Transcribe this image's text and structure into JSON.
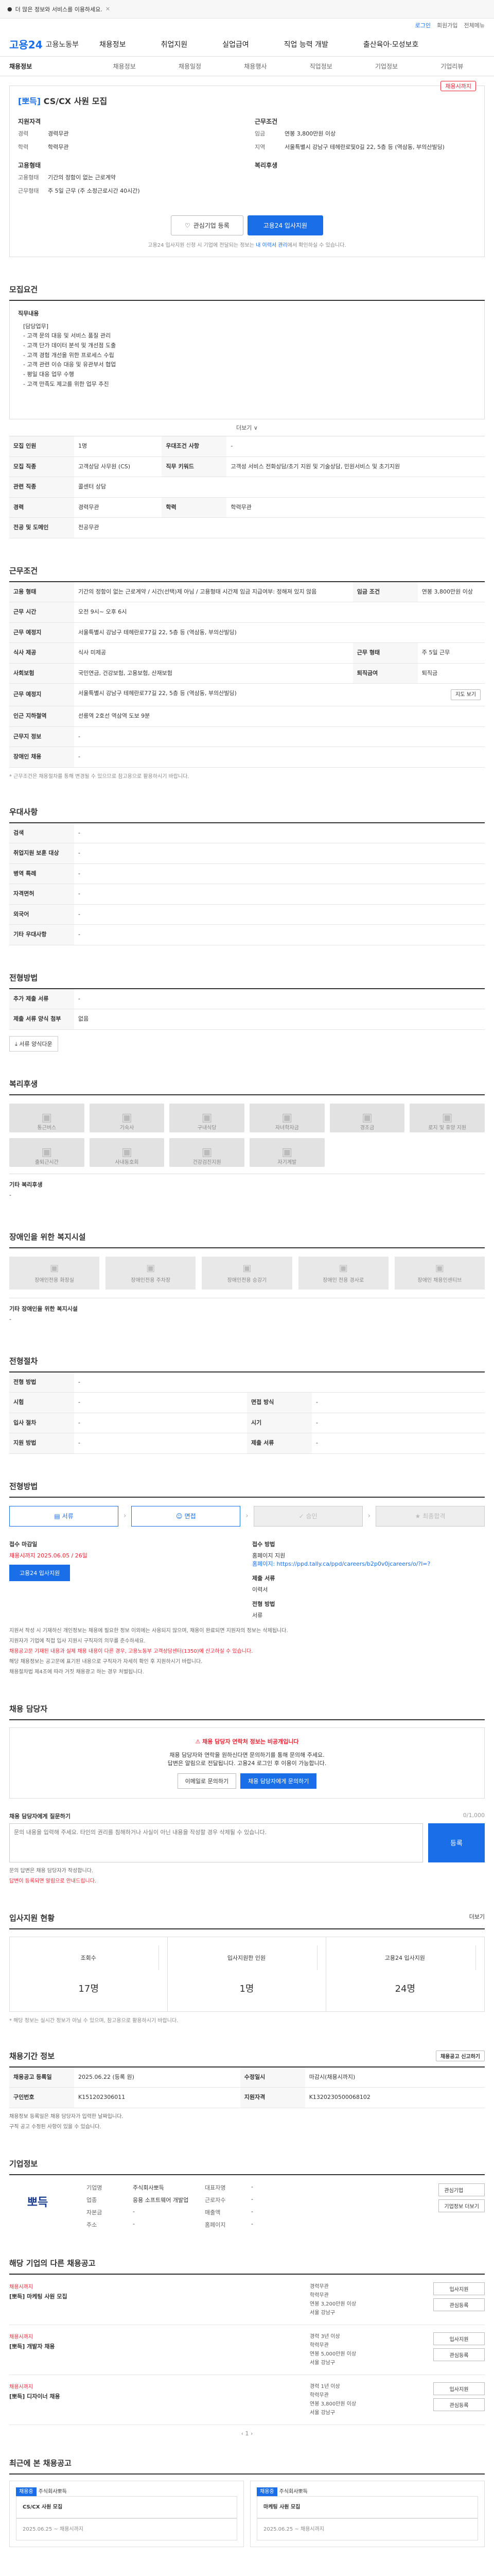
{
  "top": {
    "label": "더 많은 정보와 서비스를 이용하세요.",
    "close": "✕"
  },
  "util": {
    "login": "로그인",
    "join": "회원가입",
    "lang": "전체메뉴"
  },
  "header": {
    "logo": "고용24",
    "gov": "고용노동부",
    "gnb": [
      "채용정보",
      "취업지원",
      "실업급여",
      "직업 능력 개발",
      "출산육아·모성보호"
    ]
  },
  "subnav": {
    "first": "채용정보",
    "items": [
      "채용정보",
      "채용일정",
      "채용행사",
      "직업정보",
      "기업정보",
      "기업리뷰"
    ]
  },
  "job": {
    "company": "[뽀득]",
    "title": "CS/CX 사원 모집",
    "badge": "채용시까지",
    "left_h": "지원자격",
    "left_rows": [
      [
        "경력",
        "경력무관"
      ],
      [
        "학력",
        "학력무관"
      ]
    ],
    "left_h2": "고용형태",
    "left_rows2": [
      [
        "고용형태",
        "기간의 정함이 없는 근로계약"
      ],
      [
        "근무형태",
        "주 5일 근무 (주 소정근로시간 40시간)"
      ]
    ],
    "right_h": "근무조건",
    "right_rows": [
      [
        "임금",
        "연봉 3,800만원 이상"
      ],
      [
        "지역",
        "서울특별시 강남구 테헤란로띷0길 22, 5층 등 (역삼동, 부의산빌딩)"
      ]
    ],
    "right_h2": "복리후생",
    "btn_fav": "관심기업 등록",
    "btn_apply": "고용24 입사지원",
    "note_pre": "고용24 입사지원 신청 시 기업에 전달되는 정보는",
    "note_link": "내 이력서 관리",
    "note_post": "에서 확인하실 수 있습니다."
  },
  "detail": {
    "h": "모집요건",
    "title": "직무내용",
    "lines": [
      "[담당업무]",
      "- 고객 문의 대응 및 서비스 품질 관리",
      "- 고객 단가 데이터 분석 및 개선점 도출",
      "- 고객 경험 개선을 위한 프로세스 수립",
      "- 고객 관련 이슈 대응 및 유관부서 협업",
      "- 평일 대응 업무 수행",
      "- 고객 만족도 제고를 위한 업무 추진"
    ],
    "more": "더보기 ∨"
  },
  "req": {
    "rows": [
      [
        "모집 인원",
        "1명",
        "우대조건 사항",
        "-"
      ],
      [
        "모집 직종",
        "고객상담 사무원 (CS)",
        "직무 키워드",
        "고객성 서비스 전화상담/초기 지원 및 기술상담, 민원서비스 및 초기지원"
      ],
      [
        "관련 직종",
        "콜센터 상담",
        "",
        ""
      ],
      [
        "경력",
        "경력무관",
        "학력",
        "학력무관"
      ],
      [
        "전공 및 도메인",
        "전공무관",
        "",
        ""
      ]
    ]
  },
  "cond": {
    "h": "근무조건",
    "rows": [
      [
        "고용 형태",
        "기간의 정함이 없는 근로계약 / 시간(선택)제 아님 / 고용형태 시간제 임금 지급여부: 정해져 있지 않음",
        "임금 조건",
        "연봉 3,800만원 이상"
      ],
      [
        "근무 시간",
        "오전 9시~ 오후 6시",
        "",
        ""
      ],
      [
        "근무 예정지",
        "서울특별시 강남구 테헤란로77길 22, 5층 등 (역삼동, 부의산빌딩)",
        "",
        ""
      ],
      [
        "식사 제공",
        "식사 미제공",
        "근무 형태",
        "주 5일 근무"
      ],
      [
        "사회보험",
        "국민연금, 건강보험, 고용보험, 산재보험",
        "퇴직금여",
        "퇴직금"
      ],
      [
        "근무 예정지",
        "서울특별시 강남구 테헤란로77길 22, 5층 등 (역삼동, 부의산빌딩)",
        "",
        ""
      ],
      [
        "인근 지하철역",
        "선릉역 2호선 역삼역 도보 9분",
        "",
        ""
      ],
      [
        "근무지 정보",
        "-",
        "",
        ""
      ],
      [
        "장애인 채용",
        "-",
        "",
        ""
      ]
    ],
    "map_btn": "지도 보기",
    "foot": "* 근무조건은 채용절차를 통해 변경될 수 있으므로 참고용으로 활용하시기 바랍니다."
  },
  "priv": {
    "h": "우대사항",
    "rows": [
      [
        "검색",
        "-"
      ],
      [
        "취업지원 보훈 대상",
        "-"
      ],
      [
        "병역 특례",
        "-"
      ],
      [
        "자격면허",
        "-"
      ],
      [
        "외국어",
        "-"
      ],
      [
        "기타 우대사항",
        "-"
      ]
    ]
  },
  "proc": {
    "h": "전형방법",
    "rows": [
      [
        "추가 제출 서류",
        "-"
      ],
      [
        "제출 서류 양식 첨부",
        "없음"
      ]
    ],
    "chip": "서류 양식다운"
  },
  "welfare": {
    "h": "복리후생",
    "items": [
      "통근버스",
      "기숙사",
      "구내식당",
      "자녀학자금",
      "경조금",
      "로지 및 휴양 지원",
      "출퇴근시간",
      "사내동호회",
      "건강검진지원",
      "자기계발"
    ],
    "etc_k": "기타 복리후생",
    "etc_v": "-"
  },
  "hire": {
    "h": "장애인을 위한 복지시설",
    "items": [
      "장애인전용 화장실",
      "장애인전용 주차장",
      "장애인전용 승강기",
      "장애인 전용 경사로",
      "장애인 채용인센티브"
    ],
    "etc_k": "기타 장애인을 위한 복지시설",
    "etc_v": "-"
  },
  "apply_sec": {
    "h": "전형절차",
    "rows": [
      [
        "전형 방법",
        "-"
      ],
      [
        "시험",
        "-",
        "면접 방식",
        "-"
      ],
      [
        "입사 절차",
        "-",
        "시기",
        "-"
      ],
      [
        "지원 방법",
        "-",
        "제출 서류",
        "-"
      ]
    ]
  },
  "steps": {
    "h": "전형방법",
    "items": [
      "서류",
      "면접",
      "승인",
      "최종합격"
    ]
  },
  "applyinfo": {
    "k1": "접수 마감일",
    "v1": "채용시까지 2025.06.05 / 26일",
    "k2": "접수 방법",
    "v2": "홈페이지 지원",
    "v2b": "홈페이지: https://ppd.tally.ca/ppd/careers/b2p0v0jcareers/o/?l=?",
    "btn": "고용24 입사지원",
    "k3": "제출 서류",
    "v3": "이력서",
    "k4": "전형 방법",
    "v4": "서류",
    "notes": [
      "지원서 작성 시 기재하신 개인정보는 채용에 필요한 정보 이외에는 사용되지 않으며, 채용이 완료되면 지원자의 정보는 삭제됩니다.",
      "지원자가 기업에 직접 입사 지원시 구직자의 의무를 준수하세요.",
      "채용공고문 기재된 내용과 실제 채용 내용이 다른 경우, 고용노동부 고객상담센터(1350)에 신고하실 수 있습니다.",
      "해당 채용정보는 공고문에 표기된 내용으로 구직자가 자세히 확인 후 지원하시기 바랍니다.",
      "채용절차법 제4조에 따라 거짓 채용광고 하는 경우 처벌됩니다."
    ]
  },
  "manager": {
    "h": "채용 담당자",
    "warn": "채용 담당자 연락처 정보는 비공개입니다",
    "desc": "채용 담당자와 연락을 원하신다면 문의하기를 통해 문의해 주세요.",
    "desc2": "답변은 알림으로 전달됩니다. 고용24 로그인 후 이용이 가능합니다.",
    "btn1": "이메일로 문의하기",
    "btn2": "채용 담당자에게 문의하기"
  },
  "qa": {
    "h": "채용 담당자에게 질문하기",
    "count": "0/1,000",
    "placeholder": "문의 내용을 입력해 주세요. 타인의 권리를 침해하거나 사실이 아닌 내용을 작성할 경우 삭제될 수 있습니다.",
    "send": "등록",
    "notes": [
      "문의 답변은 채용 담당자가 작성합니다.",
      "답변이 등록되면 알림으로 안내드립니다."
    ]
  },
  "stats": {
    "h": "입사지원 현황",
    "more": "더보기",
    "items": [
      [
        "조회수",
        "17명"
      ],
      [
        "입사지원한 인원",
        "1명"
      ],
      [
        "고용24 입사지원",
        "24명"
      ]
    ],
    "foot": "* 해당 정보는 실시간 정보가 아닐 수 있으며, 참고용으로 활용하시기 바랍니다."
  },
  "recinfo": {
    "h": "채용기간 정보",
    "btn": "채용공고 신고하기",
    "rows": [
      [
        "채용공고 등록일",
        "2025.06.22 (등록 원)",
        "수정일시",
        "마감시(채용시까지)"
      ],
      [
        "구인번호",
        "K151202306011",
        "지원자격",
        "K1320230500068102"
      ]
    ],
    "notes": [
      "채용정보 등록일은 채용 담당자가 입력한 날짜입니다.",
      "구직 공고 수정된 사항이 있을 수 있습니다."
    ]
  },
  "company": {
    "h": "기업정보",
    "logo": "뽀득",
    "grid": [
      [
        "기업명",
        "주식회사뽀득",
        "대표자명",
        "-"
      ],
      [
        "업종",
        "응용 소프트웨어 개발업",
        "근로자수",
        "-"
      ],
      [
        "자본금",
        "-",
        "매출액",
        "-"
      ],
      [
        "주소",
        "-",
        "홈페이지",
        "-"
      ]
    ],
    "side": [
      "관심기업",
      "기업정보 더보기"
    ]
  },
  "related": {
    "h": "해당 기업의 다른 채용공고",
    "items": [
      {
        "tag": "채용시까지",
        "title": "[뽀득] 마케팅 사원 모집",
        "sub": "",
        "m": [
          "경력무관",
          "학력무관",
          "연봉 3,200만원 이상",
          "서울 강남구"
        ]
      },
      {
        "tag": "채용시까지",
        "title": "[뽀득] 개발자 채용",
        "sub": "",
        "m": [
          "경력 3년 이상",
          "학력무관",
          "연봉 5,000만원 이상",
          "서울 강남구"
        ]
      },
      {
        "tag": "채용시까지",
        "title": "[뽀득] 디자이너 채용",
        "sub": "",
        "m": [
          "경력 1년 이상",
          "학력무관",
          "연봉 3,800만원 이상",
          "서울 강남구"
        ]
      }
    ],
    "btns": [
      "입사지원",
      "관심등록"
    ],
    "pagin": "1"
  },
  "recent": {
    "h": "최근에 본 채용공고",
    "items": [
      {
        "badge": "채용중",
        "co": "주식회사뽀득",
        "title": "CS/CX 사원 모집",
        "date": "2025.06.25 ~ 채용시까지"
      },
      {
        "badge": "채용중",
        "co": "주식회사뽀득",
        "title": "마케팅 사원 모집",
        "date": "2025.06.25 ~ 채용시까지"
      }
    ]
  }
}
